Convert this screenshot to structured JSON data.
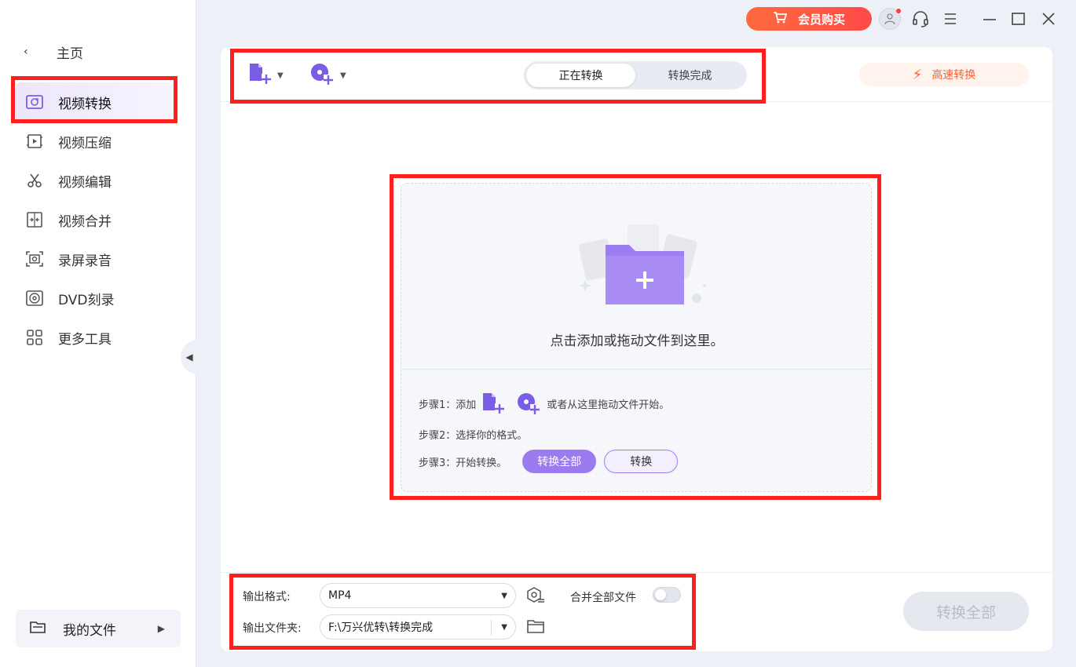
{
  "sidebar": {
    "home_label": "主页",
    "items": [
      {
        "label": "视频转换",
        "icon": "video-convert-icon",
        "active": true
      },
      {
        "label": "视频压缩",
        "icon": "video-compress-icon",
        "active": false
      },
      {
        "label": "视频编辑",
        "icon": "scissors-icon",
        "active": false
      },
      {
        "label": "视频合并",
        "icon": "merge-icon",
        "active": false
      },
      {
        "label": "录屏录音",
        "icon": "screen-record-icon",
        "active": false
      },
      {
        "label": "DVD刻录",
        "icon": "disc-icon",
        "active": false
      },
      {
        "label": "更多工具",
        "icon": "grid-icon",
        "active": false
      }
    ],
    "my_files_label": "我的文件"
  },
  "topbar": {
    "vip_label": "会员购买",
    "icons": [
      "cart-icon",
      "user-avatar-icon",
      "headset-icon",
      "menu-icon",
      "minimize-icon",
      "maximize-icon",
      "close-icon"
    ]
  },
  "toolbar": {
    "tabs": [
      {
        "label": "正在转换",
        "active": true
      },
      {
        "label": "转换完成",
        "active": false
      }
    ],
    "speed_label": "高速转换"
  },
  "dropzone": {
    "hint": "点击添加或拖动文件到这里。",
    "step1_prefix": "步骤1：添加",
    "step1_suffix": "或者从这里拖动文件开始。",
    "step2": "步骤2：选择你的格式。",
    "step3": "步骤3：开始转换。",
    "convert_all_label": "转换全部",
    "convert_label": "转换"
  },
  "bottom": {
    "format_label": "输出格式:",
    "format_value": "MP4",
    "folder_label": "输出文件夹:",
    "folder_value": "F:\\万兴优转\\转换完成",
    "merge_label": "合并全部文件",
    "merge_on": false,
    "convert_all_label": "转换全部"
  },
  "colors": {
    "accent": "#7b5ce6",
    "vip_orange": "#ff5a3c",
    "highlight_red": "#ff1f1f"
  }
}
